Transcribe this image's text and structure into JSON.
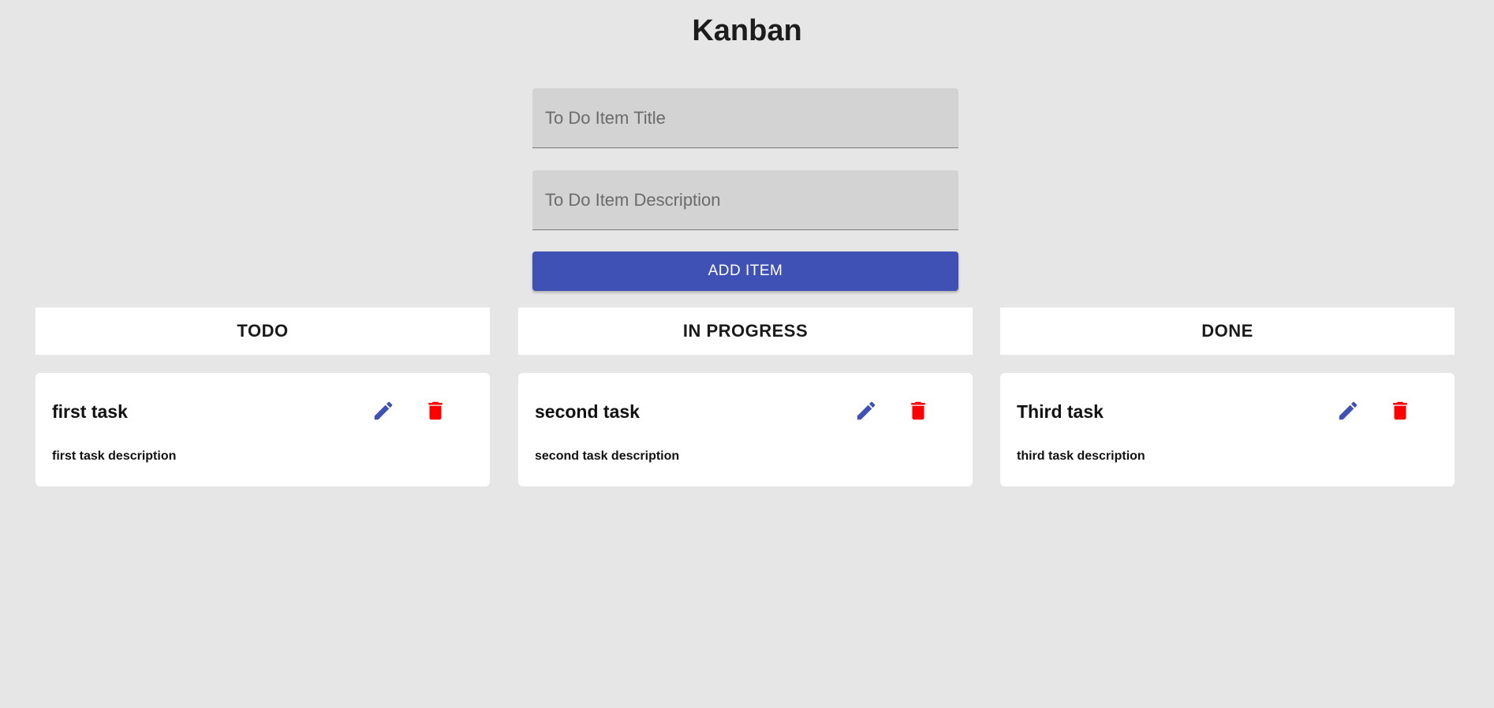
{
  "header": {
    "title": "Kanban"
  },
  "form": {
    "title_placeholder": "To Do Item Title",
    "title_value": "",
    "description_placeholder": "To Do Item Description",
    "description_value": "",
    "add_label": "ADD ITEM"
  },
  "colors": {
    "background": "#e6e6e6",
    "accent": "#3f51b5",
    "delete": "#ff0000",
    "input_fill": "#d3d3d3",
    "card": "#ffffff"
  },
  "columns": [
    {
      "header": "TODO",
      "cards": [
        {
          "title": "first task",
          "description": "first task description",
          "edit_icon": "pencil-icon",
          "delete_icon": "trash-icon"
        }
      ]
    },
    {
      "header": "IN PROGRESS",
      "cards": [
        {
          "title": "second task",
          "description": "second task description",
          "edit_icon": "pencil-icon",
          "delete_icon": "trash-icon"
        }
      ]
    },
    {
      "header": "DONE",
      "cards": [
        {
          "title": "Third task",
          "description": "third task description",
          "edit_icon": "pencil-icon",
          "delete_icon": "trash-icon"
        }
      ]
    }
  ]
}
